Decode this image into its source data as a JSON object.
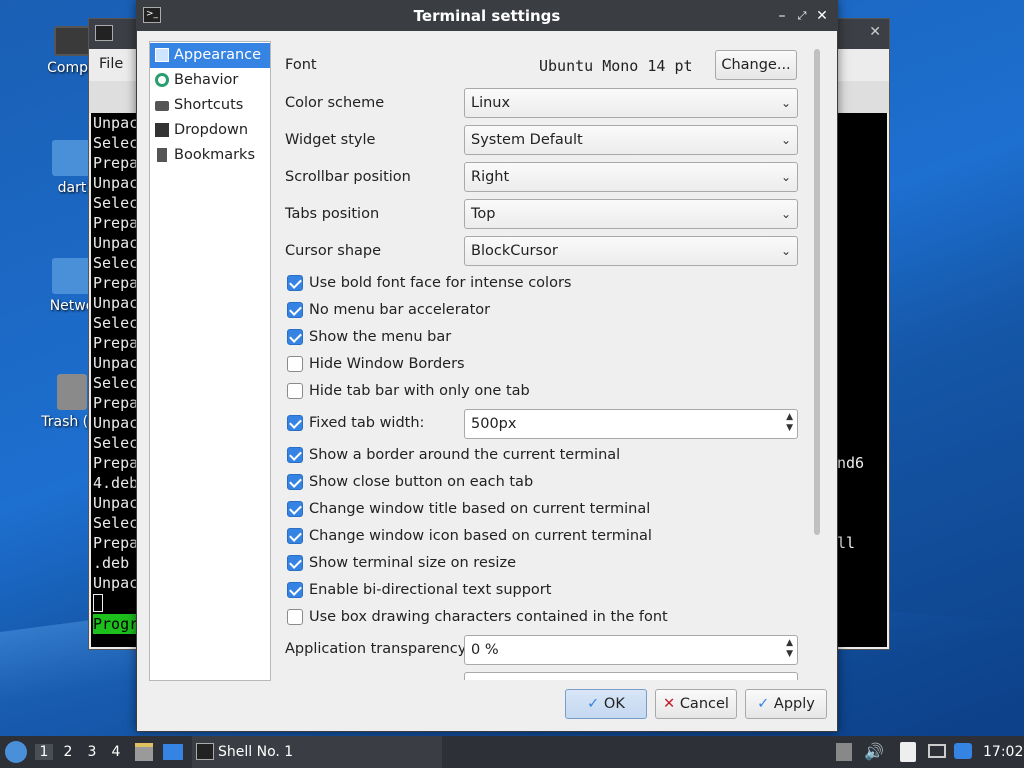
{
  "desktop": {
    "icons": [
      {
        "label": "Compu",
        "name": "computer"
      },
      {
        "label": "dart",
        "name": "home-folder"
      },
      {
        "label": "Netwo",
        "name": "network"
      },
      {
        "label": "Trash (Er",
        "name": "trash"
      }
    ]
  },
  "background_terminal": {
    "menu_file": "File",
    "lines": [
      "Unpac",
      "Selec",
      "Prepa",
      "Unpac",
      "Selec",
      "Prepa",
      "Unpac",
      "Selec",
      "Prepa",
      "Unpac",
      "Selec",
      "Prepa",
      "Unpac",
      "Selec",
      "Prepa",
      "Unpac",
      "Selec",
      "Prepa",
      "4.deb",
      "Unpac",
      "Selec",
      "Prepa",
      ".deb",
      "Unpac"
    ],
    "progress_text": "Progr",
    "right_fragments": [
      "nd6",
      "ll"
    ]
  },
  "dialog": {
    "title": "Terminal settings",
    "sidebar": [
      {
        "label": "Appearance",
        "icon": "appearance-icon",
        "selected": true
      },
      {
        "label": "Behavior",
        "icon": "behavior-icon",
        "selected": false
      },
      {
        "label": "Shortcuts",
        "icon": "keyboard-icon",
        "selected": false
      },
      {
        "label": "Dropdown",
        "icon": "terminal-icon",
        "selected": false
      },
      {
        "label": "Bookmarks",
        "icon": "bookmark-icon",
        "selected": false
      }
    ],
    "font": {
      "label": "Font",
      "value": "Ubuntu Mono 14 pt",
      "change_button": "Change..."
    },
    "color_scheme": {
      "label": "Color scheme",
      "value": "Linux"
    },
    "widget_style": {
      "label": "Widget style",
      "value": "System Default"
    },
    "scrollbar_position": {
      "label": "Scrollbar position",
      "value": "Right"
    },
    "tabs_position": {
      "label": "Tabs position",
      "value": "Top"
    },
    "cursor_shape": {
      "label": "Cursor shape",
      "value": "BlockCursor"
    },
    "checkboxes": [
      {
        "label": "Use bold font face for intense colors",
        "checked": true
      },
      {
        "label": "No menu bar accelerator",
        "checked": true
      },
      {
        "label": "Show the menu bar",
        "checked": true
      },
      {
        "label": "Hide Window Borders",
        "checked": false
      },
      {
        "label": "Hide tab bar with only one tab",
        "checked": false
      }
    ],
    "fixed_tab_width": {
      "label": "Fixed tab width:",
      "checked": true,
      "value": "500px"
    },
    "checkboxes2": [
      {
        "label": "Show a border around the current terminal",
        "checked": true
      },
      {
        "label": "Show close button on each tab",
        "checked": true
      },
      {
        "label": "Change window title based on current terminal",
        "checked": true
      },
      {
        "label": "Change window icon based on current terminal",
        "checked": true
      },
      {
        "label": "Show terminal size on resize",
        "checked": true
      },
      {
        "label": "Enable bi-directional text support",
        "checked": true
      },
      {
        "label": "Use box drawing characters contained in the font",
        "checked": false
      }
    ],
    "app_transparency": {
      "label": "Application transparency",
      "value": "0 %"
    },
    "buttons": {
      "ok": "OK",
      "cancel": "Cancel",
      "apply": "Apply"
    }
  },
  "taskbar": {
    "workspaces": [
      "1",
      "2",
      "3",
      "4"
    ],
    "active_workspace": "1",
    "task_label": "Shell No. 1",
    "clock": "17:02"
  }
}
